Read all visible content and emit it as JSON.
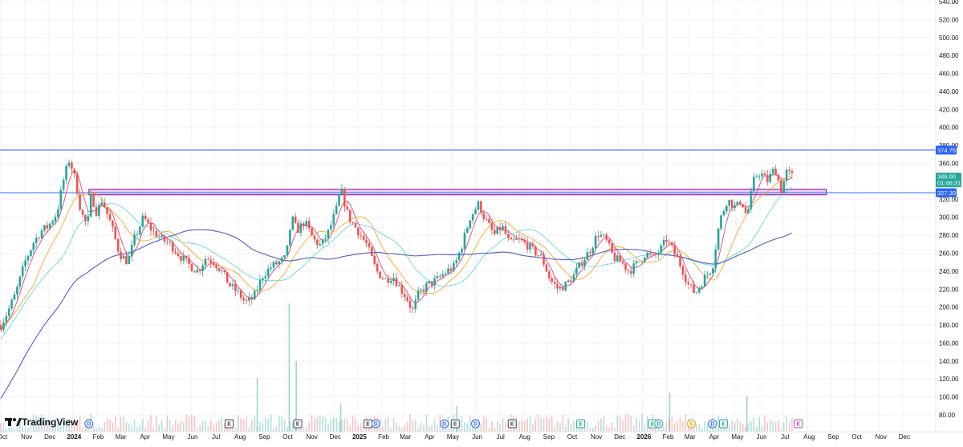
{
  "chart_data": {
    "type": "candlestick",
    "branding": "TradingView",
    "y_axis": {
      "min": 70,
      "max": 540,
      "ticks": [
        540,
        520,
        500,
        480,
        460,
        440,
        420,
        400,
        380,
        360,
        320,
        300,
        280,
        260,
        240,
        220,
        200,
        180,
        160,
        140,
        120,
        100,
        80
      ],
      "decimals": 2
    },
    "x_axis": {
      "start": "2023-10-01",
      "end": "2026-12-31",
      "labels": [
        {
          "date": "2023-10-01",
          "text": "Oct"
        },
        {
          "date": "2023-11-01",
          "text": "Nov"
        },
        {
          "date": "2023-12-01",
          "text": "Dec"
        },
        {
          "date": "2024-01-01",
          "text": "2024",
          "bold": true
        },
        {
          "date": "2024-02-01",
          "text": "Feb"
        },
        {
          "date": "2024-03-01",
          "text": "Mar"
        },
        {
          "date": "2024-04-01",
          "text": "Apr"
        },
        {
          "date": "2024-05-01",
          "text": "May"
        },
        {
          "date": "2024-06-01",
          "text": "Jun"
        },
        {
          "date": "2024-07-01",
          "text": "Jul"
        },
        {
          "date": "2024-08-01",
          "text": "Aug"
        },
        {
          "date": "2024-09-01",
          "text": "Sep"
        },
        {
          "date": "2024-10-01",
          "text": "Oct"
        },
        {
          "date": "2024-11-01",
          "text": "Nov"
        },
        {
          "date": "2024-12-01",
          "text": "Dec"
        },
        {
          "date": "2025-01-01",
          "text": "2025",
          "bold": true
        },
        {
          "date": "2025-02-01",
          "text": "Feb"
        },
        {
          "date": "2025-03-01",
          "text": "Mar"
        },
        {
          "date": "2025-04-01",
          "text": "Apr"
        },
        {
          "date": "2025-05-01",
          "text": "May"
        },
        {
          "date": "2025-06-01",
          "text": "Jun"
        },
        {
          "date": "2025-07-01",
          "text": "Jul"
        },
        {
          "date": "2025-08-01",
          "text": "Aug"
        },
        {
          "date": "2025-09-01",
          "text": "Sep"
        },
        {
          "date": "2025-10-01",
          "text": "Oct"
        },
        {
          "date": "2025-11-01",
          "text": "Nov"
        },
        {
          "date": "2025-12-01",
          "text": "Dec"
        },
        {
          "date": "2026-01-01",
          "text": "2026",
          "bold": true
        },
        {
          "date": "2026-02-01",
          "text": "Feb"
        },
        {
          "date": "2026-03-01",
          "text": "Mar"
        },
        {
          "date": "2026-04-01",
          "text": "Apr"
        },
        {
          "date": "2026-05-01",
          "text": "May"
        },
        {
          "date": "2026-06-01",
          "text": "Jun"
        },
        {
          "date": "2026-07-01",
          "text": "Jul"
        },
        {
          "date": "2026-08-01",
          "text": "Aug"
        },
        {
          "date": "2026-09-01",
          "text": "Sep"
        },
        {
          "date": "2026-10-01",
          "text": "Oct"
        },
        {
          "date": "2026-11-01",
          "text": "Nov"
        },
        {
          "date": "2026-12-01",
          "text": "Dec"
        }
      ]
    },
    "price_path": [
      [
        "2023-10-01",
        180
      ],
      [
        "2023-10-10",
        195
      ],
      [
        "2023-10-20",
        215
      ],
      [
        "2023-11-01",
        250
      ],
      [
        "2023-11-12",
        272
      ],
      [
        "2023-11-22",
        285
      ],
      [
        "2023-12-01",
        290
      ],
      [
        "2023-12-12",
        305
      ],
      [
        "2023-12-20",
        340
      ],
      [
        "2023-12-28",
        365
      ],
      [
        "2024-01-05",
        340
      ],
      [
        "2024-01-12",
        305
      ],
      [
        "2024-01-20",
        290
      ],
      [
        "2024-01-25",
        325
      ],
      [
        "2024-02-01",
        305
      ],
      [
        "2024-02-08",
        320
      ],
      [
        "2024-02-20",
        290
      ],
      [
        "2024-03-01",
        260
      ],
      [
        "2024-03-12",
        250
      ],
      [
        "2024-03-20",
        275
      ],
      [
        "2024-04-01",
        300
      ],
      [
        "2024-04-12",
        285
      ],
      [
        "2024-04-25",
        275
      ],
      [
        "2024-05-05",
        270
      ],
      [
        "2024-05-20",
        255
      ],
      [
        "2024-06-01",
        245
      ],
      [
        "2024-06-10",
        240
      ],
      [
        "2024-06-20",
        255
      ],
      [
        "2024-07-01",
        250
      ],
      [
        "2024-07-10",
        240
      ],
      [
        "2024-07-20",
        225
      ],
      [
        "2024-08-01",
        215
      ],
      [
        "2024-08-10",
        205
      ],
      [
        "2024-08-20",
        210
      ],
      [
        "2024-09-01",
        235
      ],
      [
        "2024-09-12",
        245
      ],
      [
        "2024-09-22",
        250
      ],
      [
        "2024-10-01",
        255
      ],
      [
        "2024-10-08",
        300
      ],
      [
        "2024-10-15",
        285
      ],
      [
        "2024-10-25",
        295
      ],
      [
        "2024-11-05",
        275
      ],
      [
        "2024-11-15",
        268
      ],
      [
        "2024-11-25",
        285
      ],
      [
        "2024-12-05",
        310
      ],
      [
        "2024-12-10",
        332
      ],
      [
        "2024-12-20",
        300
      ],
      [
        "2025-01-01",
        285
      ],
      [
        "2025-01-12",
        270
      ],
      [
        "2025-01-25",
        240
      ],
      [
        "2025-02-05",
        230
      ],
      [
        "2025-02-15",
        235
      ],
      [
        "2025-02-25",
        220
      ],
      [
        "2025-03-05",
        210
      ],
      [
        "2025-03-12",
        195
      ],
      [
        "2025-03-20",
        215
      ],
      [
        "2025-04-01",
        225
      ],
      [
        "2025-04-12",
        230
      ],
      [
        "2025-04-25",
        240
      ],
      [
        "2025-05-05",
        245
      ],
      [
        "2025-05-15",
        270
      ],
      [
        "2025-05-25",
        300
      ],
      [
        "2025-06-05",
        315
      ],
      [
        "2025-06-12",
        300
      ],
      [
        "2025-06-25",
        280
      ],
      [
        "2025-07-05",
        290
      ],
      [
        "2025-07-15",
        270
      ],
      [
        "2025-07-25",
        275
      ],
      [
        "2025-08-05",
        270
      ],
      [
        "2025-08-15",
        262
      ],
      [
        "2025-08-25",
        255
      ],
      [
        "2025-09-05",
        230
      ],
      [
        "2025-09-15",
        220
      ],
      [
        "2025-09-25",
        225
      ],
      [
        "2025-10-05",
        235
      ],
      [
        "2025-10-15",
        250
      ],
      [
        "2025-10-25",
        262
      ],
      [
        "2025-11-05",
        282
      ],
      [
        "2025-11-15",
        275
      ],
      [
        "2025-11-25",
        255
      ],
      [
        "2025-12-05",
        250
      ],
      [
        "2025-12-15",
        240
      ],
      [
        "2025-12-25",
        248
      ],
      [
        "2026-01-05",
        260
      ],
      [
        "2026-01-15",
        255
      ],
      [
        "2026-01-25",
        265
      ],
      [
        "2026-02-01",
        275
      ],
      [
        "2026-02-10",
        262
      ],
      [
        "2026-02-20",
        245
      ],
      [
        "2026-03-01",
        225
      ],
      [
        "2026-03-10",
        215
      ],
      [
        "2026-03-20",
        230
      ],
      [
        "2026-04-01",
        245
      ],
      [
        "2026-04-10",
        295
      ],
      [
        "2026-04-20",
        320
      ],
      [
        "2026-05-01",
        310
      ],
      [
        "2026-05-08",
        320
      ],
      [
        "2026-05-15",
        300
      ],
      [
        "2026-05-25",
        345
      ],
      [
        "2026-06-01",
        350
      ],
      [
        "2026-06-10",
        340
      ],
      [
        "2026-06-20",
        355
      ],
      [
        "2026-06-28",
        330
      ],
      [
        "2026-07-05",
        350
      ],
      [
        "2026-07-12",
        346
      ]
    ],
    "moving_averages": [
      {
        "color": "#e91e63",
        "period": 10
      },
      {
        "color": "#ff9800",
        "period": 30
      },
      {
        "color": "#4dd0e1",
        "period": 60
      },
      {
        "color": "#3f51b5",
        "period": 160
      }
    ],
    "candle_colors": {
      "up": "#26a69a",
      "down": "#ef5350"
    },
    "horizontal_lines": [
      {
        "price": 374.75,
        "label": "374.75",
        "color": "#2962ff",
        "tag_color": "#2962ff"
      },
      {
        "price": 327.3,
        "label": "327.30",
        "color": "#2962ff",
        "tag_color": "#2962ff"
      }
    ],
    "zone": {
      "from_date": "2024-01-22",
      "to_date": "2026-08-25",
      "low": 325,
      "high": 331,
      "fill": "#e1bee7",
      "stroke": "#9c27b0"
    },
    "last_price": {
      "price": 346.0,
      "label": "346.00",
      "countdown": "01:46:31",
      "tag_color": "#26a69a"
    },
    "event_markers": [
      {
        "date": "2024-01-22",
        "letter": "D",
        "kind": "dividend",
        "color": "#2962ff"
      },
      {
        "date": "2024-07-20",
        "letter": "E",
        "kind": "earnings",
        "color": "#434651"
      },
      {
        "date": "2024-10-16",
        "letter": "E",
        "kind": "earnings",
        "color": "#434651"
      },
      {
        "date": "2025-01-14",
        "letter": "E",
        "kind": "earnings",
        "color": "#434651"
      },
      {
        "date": "2025-01-24",
        "letter": "D",
        "kind": "dividend",
        "color": "#2962ff"
      },
      {
        "date": "2025-04-22",
        "letter": "D",
        "kind": "dividend",
        "color": "#2962ff"
      },
      {
        "date": "2025-05-06",
        "letter": "E",
        "kind": "earnings",
        "color": "#434651"
      },
      {
        "date": "2025-06-01",
        "letter": "D",
        "kind": "dividend",
        "color": "#2962ff"
      },
      {
        "date": "2025-07-18",
        "letter": "E",
        "kind": "earnings",
        "color": "#434651"
      },
      {
        "date": "2025-10-14",
        "letter": "E",
        "kind": "earnings",
        "color": "#26a69a"
      },
      {
        "date": "2026-01-14",
        "letter": "E",
        "kind": "earnings",
        "color": "#26a69a"
      },
      {
        "date": "2026-01-22",
        "letter": "D",
        "kind": "dividend",
        "color": "#26a69a"
      },
      {
        "date": "2026-03-05",
        "letter": "S",
        "kind": "split",
        "color": "#ff9800"
      },
      {
        "date": "2026-04-01",
        "letter": "D",
        "kind": "dividend",
        "color": "#2962ff"
      },
      {
        "date": "2026-04-15",
        "letter": "E",
        "kind": "earnings",
        "color": "#26a69a"
      },
      {
        "date": "2026-07-20",
        "letter": "E",
        "kind": "earnings",
        "color": "#ab47bc"
      }
    ],
    "volume_spikes": [
      {
        "date": "2024-10-05",
        "value": 1.0
      },
      {
        "date": "2024-10-14",
        "value": 0.55
      },
      {
        "date": "2024-08-25",
        "value": 0.42
      },
      {
        "date": "2026-05-15",
        "value": 0.28
      },
      {
        "date": "2024-12-10",
        "value": 0.22
      },
      {
        "date": "2025-05-08",
        "value": 0.2
      },
      {
        "date": "2026-02-05",
        "value": 0.3
      }
    ]
  }
}
